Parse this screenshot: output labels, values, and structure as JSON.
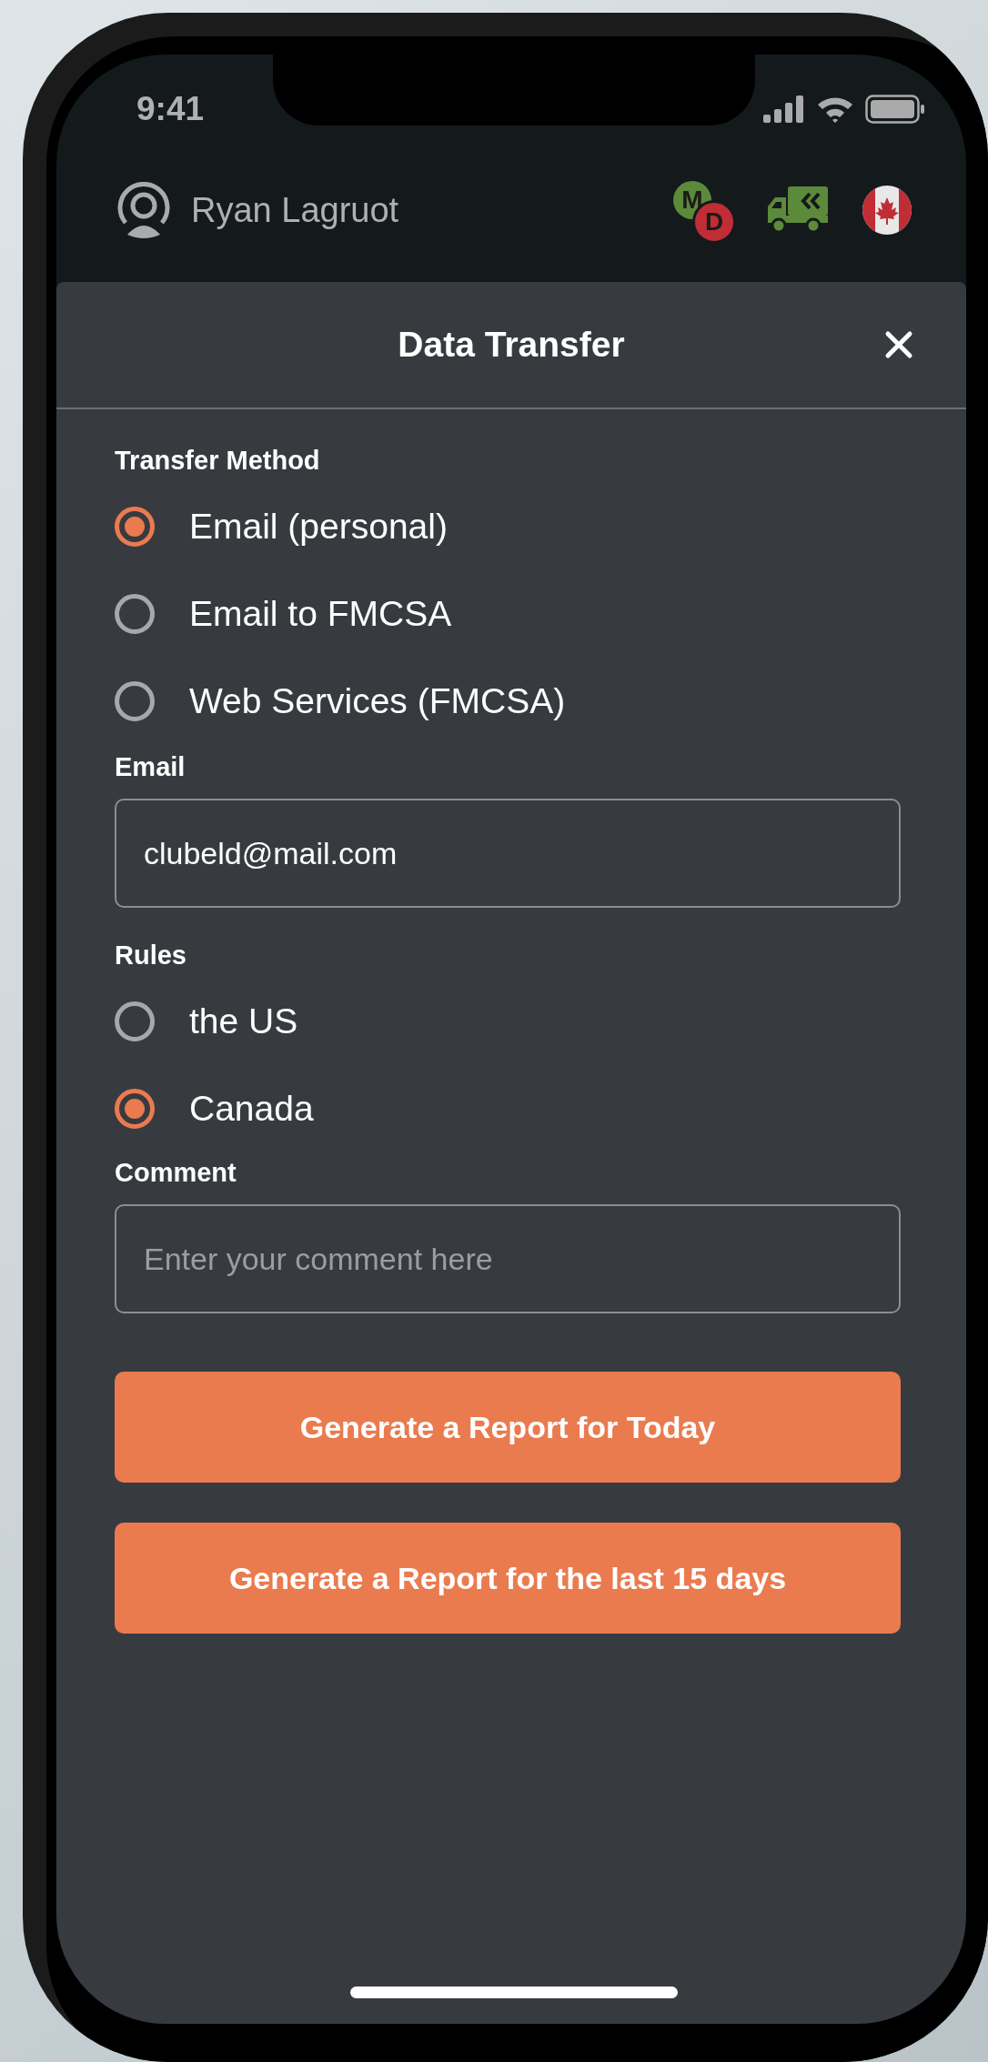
{
  "status_bar": {
    "time": "9:41"
  },
  "header": {
    "user_name": "Ryan Lagruot",
    "status_badge": {
      "top_letter": "M",
      "bottom_letter": "D"
    }
  },
  "dialog": {
    "title": "Data Transfer",
    "transfer_method": {
      "label": "Transfer Method",
      "options": [
        {
          "label": "Email (personal)",
          "selected": true
        },
        {
          "label": "Email to FMCSA",
          "selected": false
        },
        {
          "label": "Web Services (FMCSA)",
          "selected": false
        }
      ]
    },
    "email": {
      "label": "Email",
      "value": "clubeld@mail.com"
    },
    "rules": {
      "label": "Rules",
      "options": [
        {
          "label": "the US",
          "selected": false
        },
        {
          "label": "Canada",
          "selected": true
        }
      ]
    },
    "comment": {
      "label": "Comment",
      "placeholder": "Enter your comment here"
    },
    "buttons": [
      "Generate a Report for Today",
      "Generate a Report for the last 15 days"
    ]
  }
}
